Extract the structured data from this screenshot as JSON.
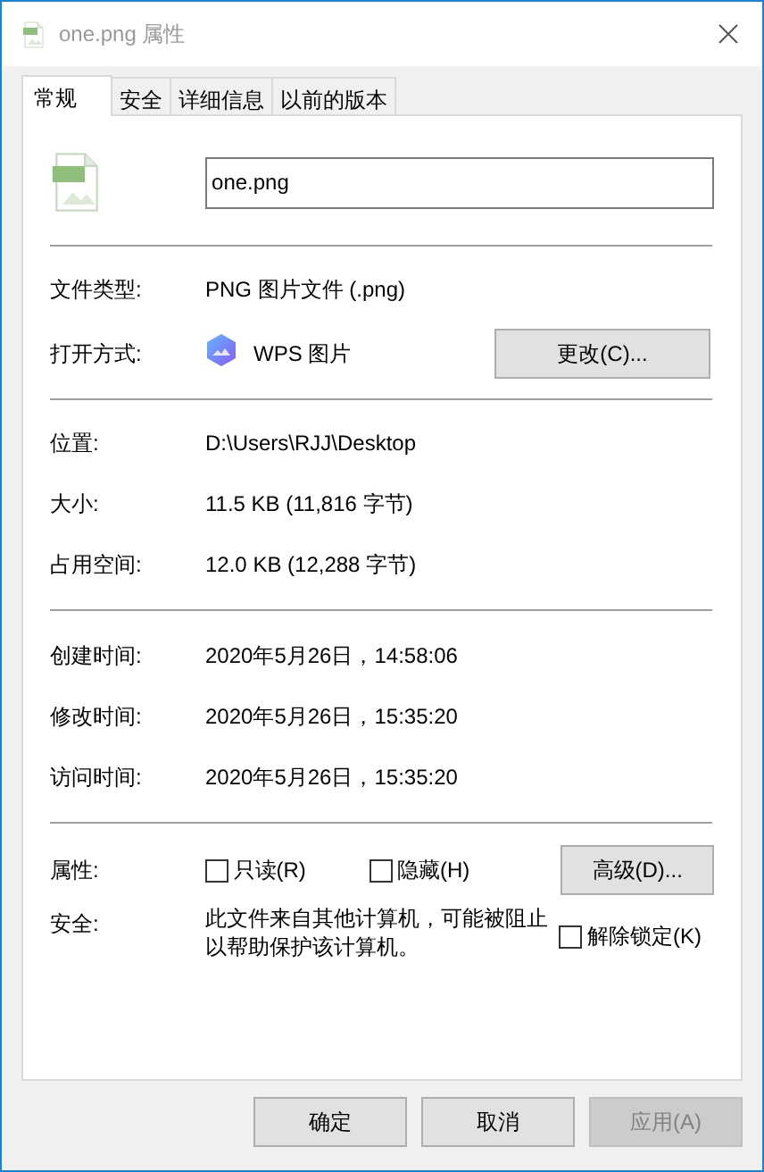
{
  "window": {
    "title": "one.png 属性"
  },
  "tabs": [
    {
      "label": "常规",
      "selected": true
    },
    {
      "label": "安全",
      "selected": false
    },
    {
      "label": "详细信息",
      "selected": false
    },
    {
      "label": "以前的版本",
      "selected": false
    }
  ],
  "file_name": {
    "value": "one.png"
  },
  "type_section": [
    {
      "label": "文件类型:",
      "value": "PNG 图片文件 (.png)"
    },
    {
      "label": "打开方式:",
      "value": "WPS 图片",
      "button": "更改(C)..."
    }
  ],
  "location_section": [
    {
      "label": "位置:",
      "value": "D:\\Users\\RJJ\\Desktop"
    },
    {
      "label": "大小:",
      "value": "11.5 KB (11,816 字节)"
    },
    {
      "label": "占用空间:",
      "value": "12.0 KB (12,288 字节)"
    }
  ],
  "time_section": [
    {
      "label": "创建时间:",
      "value": "2020年5月26日，14:58:06"
    },
    {
      "label": "修改时间:",
      "value": "2020年5月26日，15:35:20"
    },
    {
      "label": "访问时间:",
      "value": "2020年5月26日，15:35:20"
    }
  ],
  "attributes": {
    "label": "属性:",
    "checkboxes": [
      {
        "label": "只读(R)",
        "checked": false
      },
      {
        "label": "隐藏(H)",
        "checked": false
      }
    ],
    "button": "高级(D)..."
  },
  "security": {
    "label": "安全:",
    "text": "此文件来自其他计算机，可能被阻止以帮助保护该计算机。",
    "checkbox": {
      "label": "解除锁定(K)",
      "checked": false
    }
  },
  "buttons": [
    {
      "label": "确定",
      "disabled": false
    },
    {
      "label": "取消",
      "disabled": false
    },
    {
      "label": "应用(A)",
      "disabled": true
    }
  ]
}
